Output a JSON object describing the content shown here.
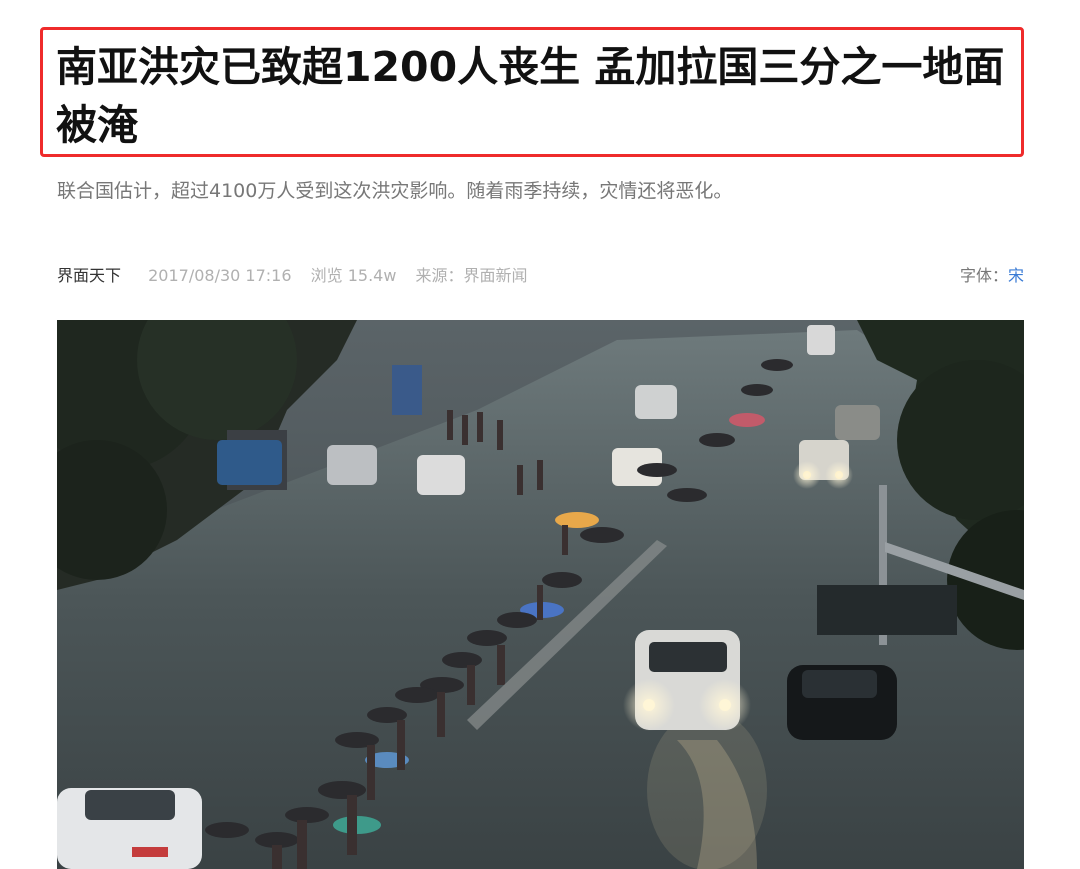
{
  "article": {
    "title": "南亚洪灾已致超1200人丧生 孟加拉国三分之一地面被淹",
    "subtitle": "联合国估计，超过4100万人受到这次洪灾影响。随着雨季持续，灾情还将恶化。",
    "meta": {
      "channel": "界面天下",
      "datetime": "2017/08/30 17:16",
      "views": "浏览 15.4w",
      "source": "来源：界面新闻",
      "font_label": "字体：",
      "font_value": "宋"
    }
  },
  "colors": {
    "highlight_border": "#ef2b2b",
    "title_text": "#111111",
    "subtitle_text": "#777777",
    "meta_text": "#b0b0b0",
    "link_blue": "#3a7bd5"
  }
}
